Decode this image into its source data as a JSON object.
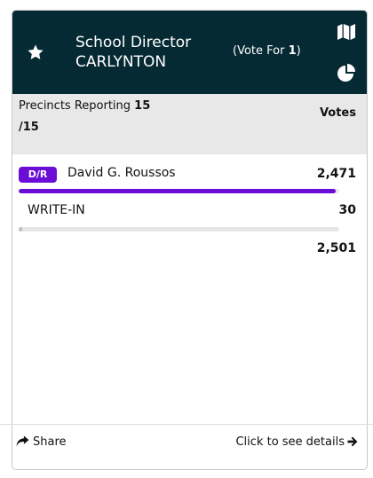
{
  "header": {
    "title_line1": "School Director",
    "title_line2": "CARLYNTON",
    "vote_for_prefix": "(Vote For ",
    "vote_for_count": "1",
    "vote_for_suffix": ")",
    "background_color": "#062a33"
  },
  "subheader": {
    "precincts_label": "Precincts Reporting ",
    "precincts_reporting": "15",
    "precincts_total": "/15",
    "votes_header": "Votes"
  },
  "candidates": [
    {
      "party": "D/R",
      "party_color": "#6a0dd6",
      "name": "David G. Roussos",
      "votes": "2,471",
      "share": 0.988
    },
    {
      "party": "",
      "name": "WRITE-IN",
      "votes": "30",
      "share": 0.012
    }
  ],
  "total_votes": "2,501",
  "footer": {
    "share_label": "Share",
    "details_label": "Click to see details"
  },
  "icons": [
    "star-icon",
    "map-icon",
    "pie-chart-icon",
    "share-icon",
    "arrow-right-icon"
  ]
}
